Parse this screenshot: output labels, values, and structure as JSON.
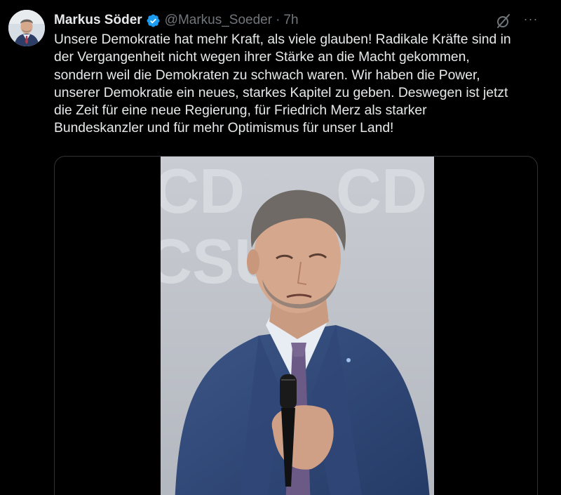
{
  "author": {
    "display_name": "Markus Söder",
    "handle": "@Markus_Soeder",
    "separator": "·",
    "time": "7h",
    "verified": true
  },
  "icons": {
    "verified": "verified-badge-icon",
    "grok": "grok-icon",
    "more": "more-icon"
  },
  "more_glyph": "···",
  "tweet": {
    "lines": [
      "Unsere Demokratie hat mehr Kraft, als viele glauben! Radikale Kräfte sind in",
      "der Vergangenheit nicht wegen ihrer Stärke an die Macht gekommen,",
      "sondern weil die Demokraten zu schwach waren. Wir haben die Power,",
      "unserer Demokratie ein neues, starkes Kapitel zu geben. Deswegen ist jetzt",
      "die Zeit für eine neue Regierung, für Friedrich Merz als starker",
      "Bundeskanzler und für mehr Optimismus für unser Land!"
    ]
  },
  "media": {
    "backdrop_text_1": "CD",
    "backdrop_text_2": "CSU",
    "backdrop_text_3": "CD"
  },
  "colors": {
    "background": "#000000",
    "text": "#e7e9ea",
    "secondary": "#71767b",
    "verified": "#1d9bf0",
    "border": "#2f3336"
  }
}
